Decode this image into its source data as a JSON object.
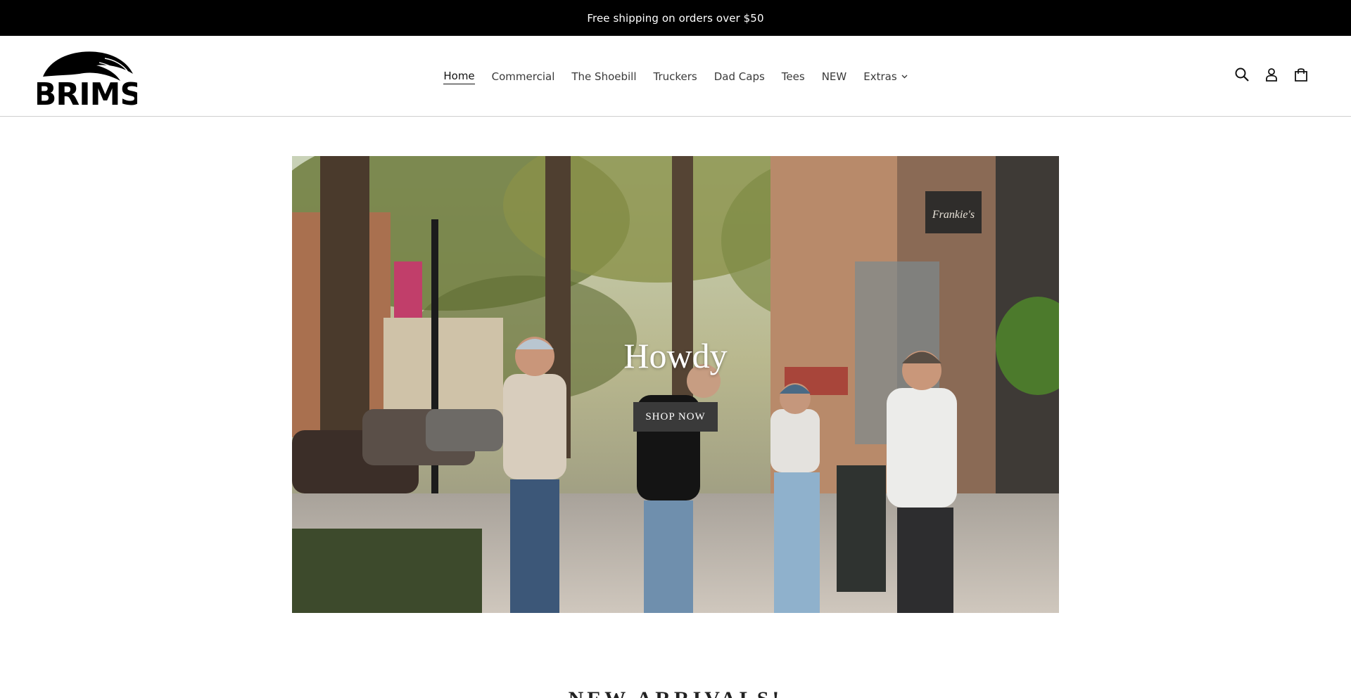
{
  "announcement": {
    "text": "Free shipping on orders over $50"
  },
  "brand": {
    "logo_text": "BRIMS"
  },
  "nav": {
    "items": [
      {
        "label": "Home",
        "active": true
      },
      {
        "label": "Commercial"
      },
      {
        "label": "The Shoebill"
      },
      {
        "label": "Truckers"
      },
      {
        "label": "Dad Caps"
      },
      {
        "label": "Tees"
      },
      {
        "label": "NEW"
      },
      {
        "label": "Extras",
        "has_dropdown": true
      }
    ]
  },
  "header_icons": [
    "search-icon",
    "account-icon",
    "cart-icon"
  ],
  "hero": {
    "title": "Howdy",
    "button_label": "SHOP NOW",
    "sign_text": "Frankie's"
  },
  "sections": {
    "new_arrivals_title": "NEW ARRIVALS!"
  },
  "colors": {
    "announcement_bg": "#000000",
    "button_bg": "#3a3a3a",
    "text": "#121212"
  }
}
